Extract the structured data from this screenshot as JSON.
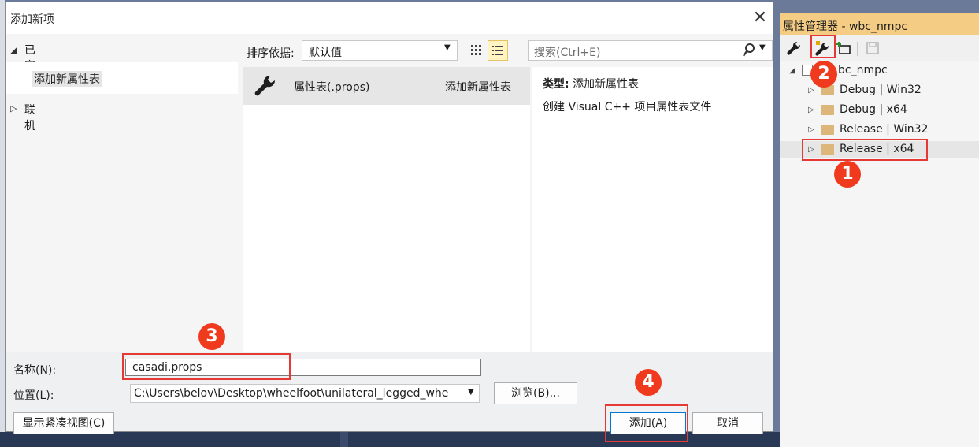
{
  "dialog": {
    "title": "添加新项",
    "close_glyph": "✕",
    "tree": {
      "installed_label": "已安装",
      "selected_item": "添加新属性表",
      "online_label": "联机"
    },
    "toolbar": {
      "sort_label": "排序依据:",
      "sort_value": "默认值",
      "search_placeholder": "搜索(Ctrl+E)"
    },
    "templates": [
      {
        "name": "属性表(.props)",
        "category": "添加新属性表"
      }
    ],
    "detail": {
      "type_key": "类型:",
      "type_value": "添加新属性表",
      "description": "创建 Visual C++ 项目属性表文件"
    },
    "form": {
      "name_label": "名称(N):",
      "name_value": "casadi.props",
      "location_label": "位置(L):",
      "location_value": "C:\\Users\\belov\\Desktop\\wheelfoot\\unilateral_legged_whe",
      "browse_button": "浏览(B)...",
      "compact_button": "显示紧凑视图(C)",
      "add_button": "添加(A)",
      "cancel_button": "取消"
    }
  },
  "property_manager": {
    "title": "属性管理器 - wbc_nmpc",
    "project": "wbc_nmpc",
    "project_visible_text": "bc_nmpc",
    "configs": [
      "Debug | Win32",
      "Debug | x64",
      "Release | Win32",
      "Release | x64"
    ],
    "selected_config": "Release | x64"
  },
  "annotations": {
    "colors": {
      "box": "#e53935",
      "badge": "#f03a1e"
    },
    "badges": [
      "1",
      "2",
      "3",
      "4"
    ]
  }
}
